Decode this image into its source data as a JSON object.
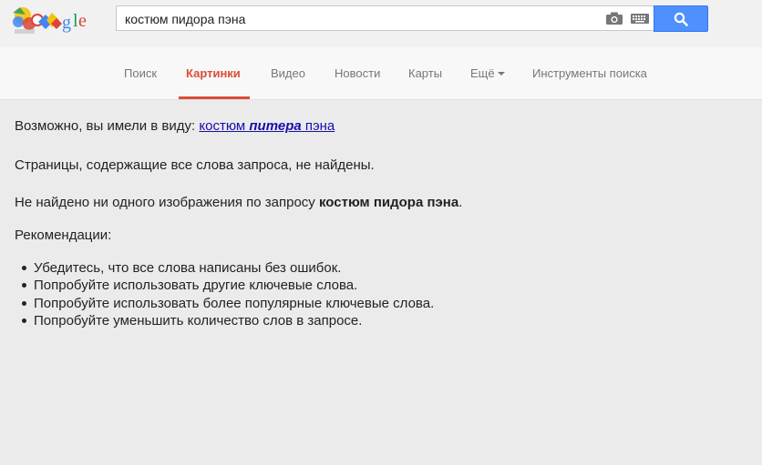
{
  "search": {
    "query": "костюм пидора пэна"
  },
  "nav": {
    "items": [
      {
        "label": "Поиск"
      },
      {
        "label": "Картинки"
      },
      {
        "label": "Видео"
      },
      {
        "label": "Новости"
      },
      {
        "label": "Карты"
      },
      {
        "label": "Ещё"
      },
      {
        "label": "Инструменты поиска"
      }
    ],
    "active": "Картинки"
  },
  "results": {
    "did_you_mean_prefix": "Возможно, вы имели в виду:",
    "suggestion_part1": "костюм",
    "suggestion_bold": "питера",
    "suggestion_part2": "пэна",
    "no_pages": "Страницы, содержащие все слова запроса, не найдены.",
    "no_images_prefix": "Не найдено ни одного изображения по запросу",
    "no_images_query": "костюм пидора пэна",
    "no_images_suffix": ".",
    "recommendations_title": "Рекомендации:",
    "tips": [
      "Убедитесь, что все слова написаны без ошибок.",
      "Попробуйте использовать другие ключевые слова.",
      "Попробуйте использовать более популярные ключевые слова.",
      "Попробуйте уменьшить количество слов в запросе."
    ]
  },
  "colors": {
    "accent": "#dd4b39",
    "search_button": "#4d90fe",
    "link": "#1a0dab"
  },
  "icons": [
    "google-doodle-logo",
    "camera-icon",
    "keyboard-icon",
    "search-icon"
  ]
}
